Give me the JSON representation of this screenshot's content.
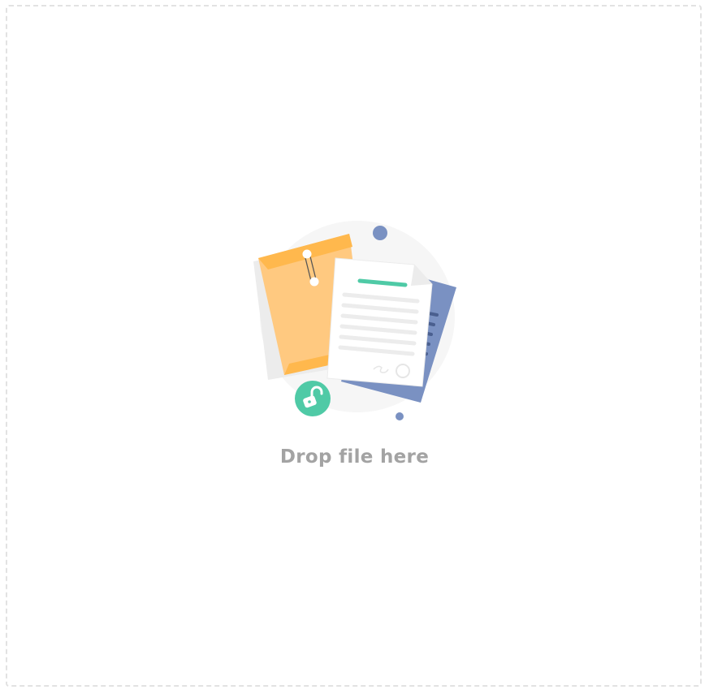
{
  "dropzone": {
    "label": "Drop file here"
  },
  "illustration": {
    "icons": [
      "envelope-icon",
      "document-icon",
      "lock-icon"
    ],
    "colors": {
      "envelope": "#ffc980",
      "envelope_flap": "#ffb84d",
      "back_sheet": "#7a91c2",
      "document": "#ffffff",
      "accent_line": "#4fcaa6",
      "lock_badge": "#4fcaa6",
      "blob": "#f6f6f6",
      "dot": "#7a91c2"
    }
  }
}
